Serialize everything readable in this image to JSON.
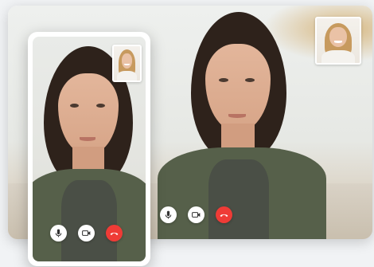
{
  "desktop_window": {
    "main_video": {
      "participant": "woman-in-green-jacket"
    },
    "self_view": {
      "participant": "smiling-blonde-woman"
    },
    "controls": [
      {
        "name": "microphone",
        "icon": "microphone-icon"
      },
      {
        "name": "camera",
        "icon": "video-camera-icon"
      },
      {
        "name": "end-call",
        "icon": "hang-up-icon",
        "color": "#ef3b36"
      }
    ]
  },
  "phone": {
    "main_video": {
      "participant": "woman-in-green-jacket"
    },
    "self_view": {
      "participant": "smiling-blonde-woman"
    },
    "controls": [
      {
        "name": "microphone",
        "icon": "microphone-icon"
      },
      {
        "name": "camera",
        "icon": "video-camera-icon"
      },
      {
        "name": "end-call",
        "icon": "hang-up-icon",
        "color": "#ef3b36"
      }
    ]
  },
  "colors": {
    "end_call": "#ef3b36",
    "jacket": "#56604a",
    "hair": "#2e221b",
    "frame": "#ffffff"
  }
}
